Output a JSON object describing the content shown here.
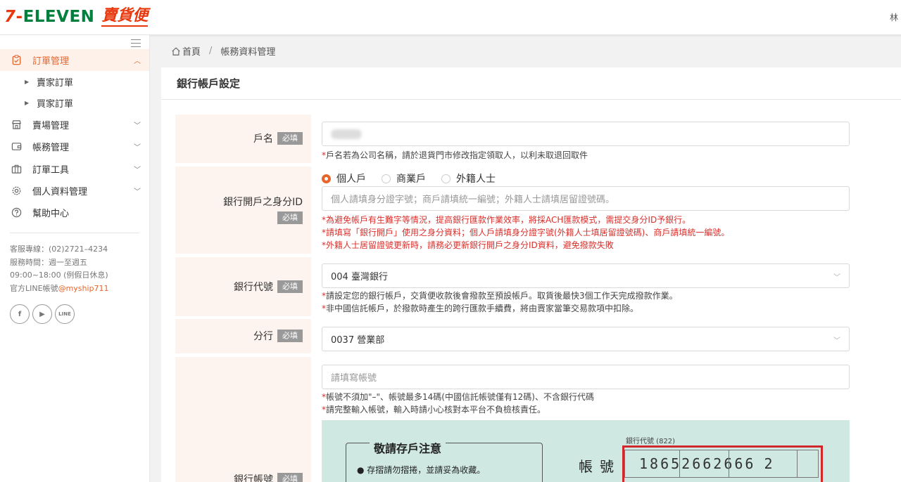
{
  "brand": {
    "logo_seven": "7",
    "logo_dash": "-",
    "logo_eleven": "ELEVEN",
    "logo_name": "賣貨便",
    "user_initial": "林"
  },
  "sidebar": {
    "menu": [
      {
        "label": "訂單管理",
        "icon": "clipboard-icon",
        "expanded": true
      },
      {
        "label": "賣場管理",
        "icon": "store-icon"
      },
      {
        "label": "帳務管理",
        "icon": "wallet-icon"
      },
      {
        "label": "訂單工具",
        "icon": "briefcase-icon"
      },
      {
        "label": "個人資料管理",
        "icon": "gear-icon"
      },
      {
        "label": "幫助中心",
        "icon": "help-icon"
      }
    ],
    "submenu": [
      "賣家訂單",
      "買家訂單"
    ],
    "service_hotline": "客服專線：(02)2721–4234",
    "service_hours": "服務時間：週一至週五",
    "service_time": "09:00~18:00 (例假日休息)",
    "line_prefix": "官方LINE帳號",
    "line_id": "@myship711",
    "social": [
      "f",
      "▶",
      "LINE"
    ]
  },
  "breadcrumb": {
    "home": "首頁",
    "sep": "/",
    "current": "帳務資料管理"
  },
  "page": {
    "title": "銀行帳戶設定",
    "required_badge": "必填",
    "account_name": {
      "label": "戶名",
      "note": "戶名若為公司名稱，請於退貨門市修改指定領取人，以利未取退回取件"
    },
    "id_field": {
      "label": "銀行開戶之身分ID",
      "options": [
        "個人戶",
        "商業戶",
        "外籍人士"
      ],
      "selected": "個人戶",
      "placeholder": "個人請填身分證字號；商戶請填統一編號；外籍人士請填居留證號碼。",
      "notes": [
        "為避免帳戶有生難字等情況，提高銀行匯款作業效率，將採ACH匯款模式，需提交身分ID予銀行。",
        "請填寫「銀行開戶」使用之身分資料；個人戶請填身分證字號(外籍人士填居留證號碼)、商戶請填統一編號。",
        "外籍人士居留證號更新時，請務必更新銀行開戶之身分ID資料，避免撥款失敗"
      ]
    },
    "bank_code": {
      "label": "銀行代號",
      "value": "004 臺灣銀行",
      "notes": [
        "請設定您的銀行帳戶，交貨便收款後會撥款至預設帳戶。取貨後最快3個工作天完成撥款作業。",
        "非中國信託帳戶，於撥款時產生的跨行匯款手續費，將由賣家當筆交易款項中扣除。"
      ]
    },
    "branch": {
      "label": "分行",
      "value": "0037 營業部"
    },
    "account_number": {
      "label": "銀行帳號",
      "placeholder": "請填寫帳號",
      "notes": [
        "帳號不須加\"–\"、帳號最多14碼(中國信託帳號僅有12碼)、不含銀行代碼",
        "請完整輸入帳號，輸入時請小心核對本平台不負檢核責任。"
      ]
    },
    "passbook": {
      "heading": "敬請存戶注意",
      "line1": "● 存摺請勿摺捲，並請妥為收藏。",
      "acct_label": "帳號",
      "bank_code_label": "銀行代號 (822)",
      "number": "18652662666",
      "last_digit": "2"
    }
  },
  "colors": {
    "accent": "#e8652c",
    "brand_red": "#e8390e",
    "brand_green": "#017f3c",
    "note_red": "#d9302c",
    "label_bg": "#fdf4ef"
  }
}
